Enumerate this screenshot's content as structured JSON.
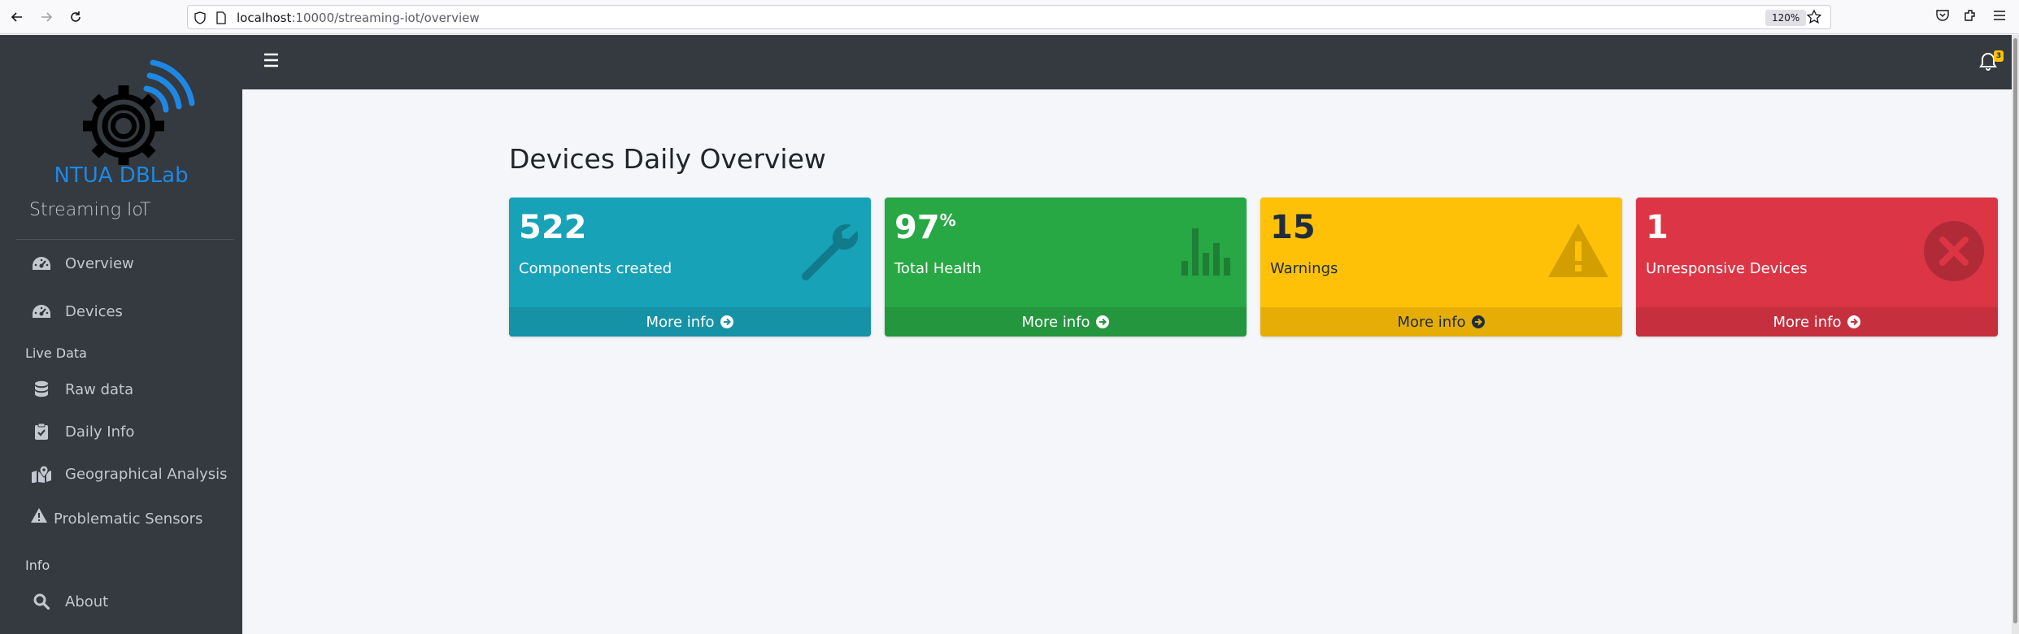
{
  "browser": {
    "url_host": "localhost",
    "url_rest": ":10000/streaming-iot/overview",
    "zoom": "120%"
  },
  "sidebar": {
    "brand_name": "NTUA DBLab",
    "brand_subtitle": "Streaming IoT",
    "items": [
      {
        "label": "Overview",
        "icon": "tachometer-icon"
      },
      {
        "label": "Devices",
        "icon": "tachometer-icon"
      },
      {
        "label": "Raw data",
        "icon": "database-icon"
      },
      {
        "label": "Daily Info",
        "icon": "clipboard-check-icon"
      },
      {
        "label": "Geographical Analysis",
        "icon": "map-marked-icon"
      },
      {
        "label": "Problematic Sensors",
        "icon": "warning-icon"
      },
      {
        "label": "About",
        "icon": "search-icon"
      }
    ],
    "headers": [
      "Live Data",
      "Info"
    ]
  },
  "topbar": {
    "notification_count": "3"
  },
  "main": {
    "title": "Devices Daily Overview",
    "cards": [
      {
        "value": "522",
        "suffix": "",
        "label": "Components created",
        "footer": "More info",
        "color": "#17a2b8",
        "icon": "wrench-icon"
      },
      {
        "value": "97",
        "suffix": "%",
        "label": "Total Health",
        "footer": "More info",
        "color": "#28a745",
        "icon": "bar-chart-icon"
      },
      {
        "value": "15",
        "suffix": "",
        "label": "Warnings",
        "footer": "More info",
        "color": "#ffc107",
        "icon": "warning-icon"
      },
      {
        "value": "1",
        "suffix": "",
        "label": "Unresponsive Devices",
        "footer": "More info",
        "color": "#dc3545",
        "icon": "times-circle-icon"
      }
    ]
  }
}
